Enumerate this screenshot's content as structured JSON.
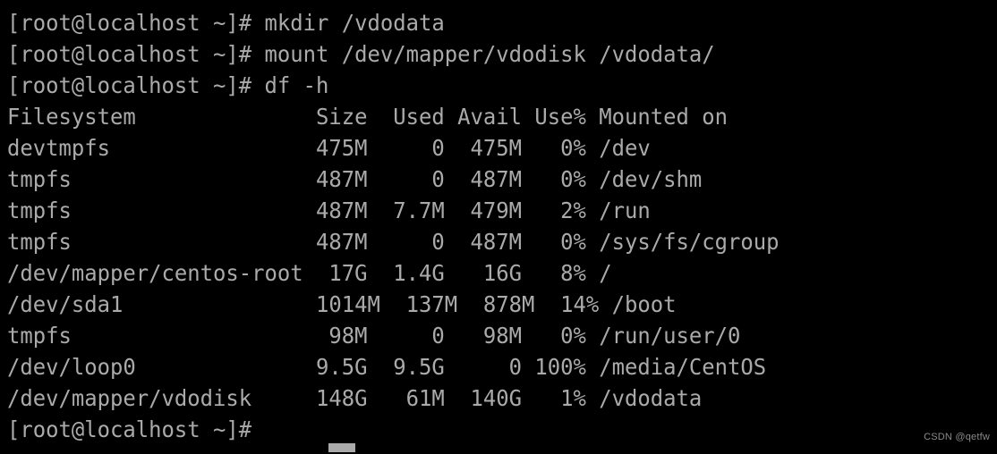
{
  "terminal": {
    "prompt": "[root@localhost ~]#",
    "background_color": "#000000",
    "text_color": "#aaaaaa",
    "lines": [
      "[root@localhost ~]# mkdir /vdodata",
      "[root@localhost ~]# mount /dev/mapper/vdodisk /vdodata/",
      "[root@localhost ~]# df -h",
      "Filesystem              Size  Used Avail Use% Mounted on",
      "devtmpfs                475M     0  475M   0% /dev",
      "tmpfs                   487M     0  487M   0% /dev/shm",
      "tmpfs                   487M  7.7M  479M   2% /run",
      "tmpfs                   487M     0  487M   0% /sys/fs/cgroup",
      "/dev/mapper/centos-root  17G  1.4G   16G   8% /",
      "/dev/sda1               1014M  137M  878M  14% /boot",
      "tmpfs                    98M     0   98M   0% /run/user/0",
      "/dev/loop0              9.5G  9.5G     0 100% /media/CentOS",
      "/dev/mapper/vdodisk     148G   61M  140G   1% /vdodata",
      "[root@localhost ~]#"
    ],
    "commands": [
      "mkdir /vdodata",
      "mount /dev/mapper/vdodisk /vdodata/",
      "df -h"
    ],
    "df_table": {
      "headers": [
        "Filesystem",
        "Size",
        "Used",
        "Avail",
        "Use%",
        "Mounted on"
      ],
      "rows": [
        {
          "filesystem": "devtmpfs",
          "size": "475M",
          "used": "0",
          "avail": "475M",
          "use_pct": "0%",
          "mounted_on": "/dev"
        },
        {
          "filesystem": "tmpfs",
          "size": "487M",
          "used": "0",
          "avail": "487M",
          "use_pct": "0%",
          "mounted_on": "/dev/shm"
        },
        {
          "filesystem": "tmpfs",
          "size": "487M",
          "used": "7.7M",
          "avail": "479M",
          "use_pct": "2%",
          "mounted_on": "/run"
        },
        {
          "filesystem": "tmpfs",
          "size": "487M",
          "used": "0",
          "avail": "487M",
          "use_pct": "0%",
          "mounted_on": "/sys/fs/cgroup"
        },
        {
          "filesystem": "/dev/mapper/centos-root",
          "size": "17G",
          "used": "1.4G",
          "avail": "16G",
          "use_pct": "8%",
          "mounted_on": "/"
        },
        {
          "filesystem": "/dev/sda1",
          "size": "1014M",
          "used": "137M",
          "avail": "878M",
          "use_pct": "14%",
          "mounted_on": "/boot"
        },
        {
          "filesystem": "tmpfs",
          "size": "98M",
          "used": "0",
          "avail": "98M",
          "use_pct": "0%",
          "mounted_on": "/run/user/0"
        },
        {
          "filesystem": "/dev/loop0",
          "size": "9.5G",
          "used": "9.5G",
          "avail": "0",
          "use_pct": "100%",
          "mounted_on": "/media/CentOS"
        },
        {
          "filesystem": "/dev/mapper/vdodisk",
          "size": "148G",
          "used": "61M",
          "avail": "140G",
          "use_pct": "1%",
          "mounted_on": "/vdodata"
        }
      ]
    },
    "cursor": {
      "visible": true,
      "style": "block-underline"
    }
  },
  "watermark": {
    "text": "CSDN @qetfw"
  }
}
